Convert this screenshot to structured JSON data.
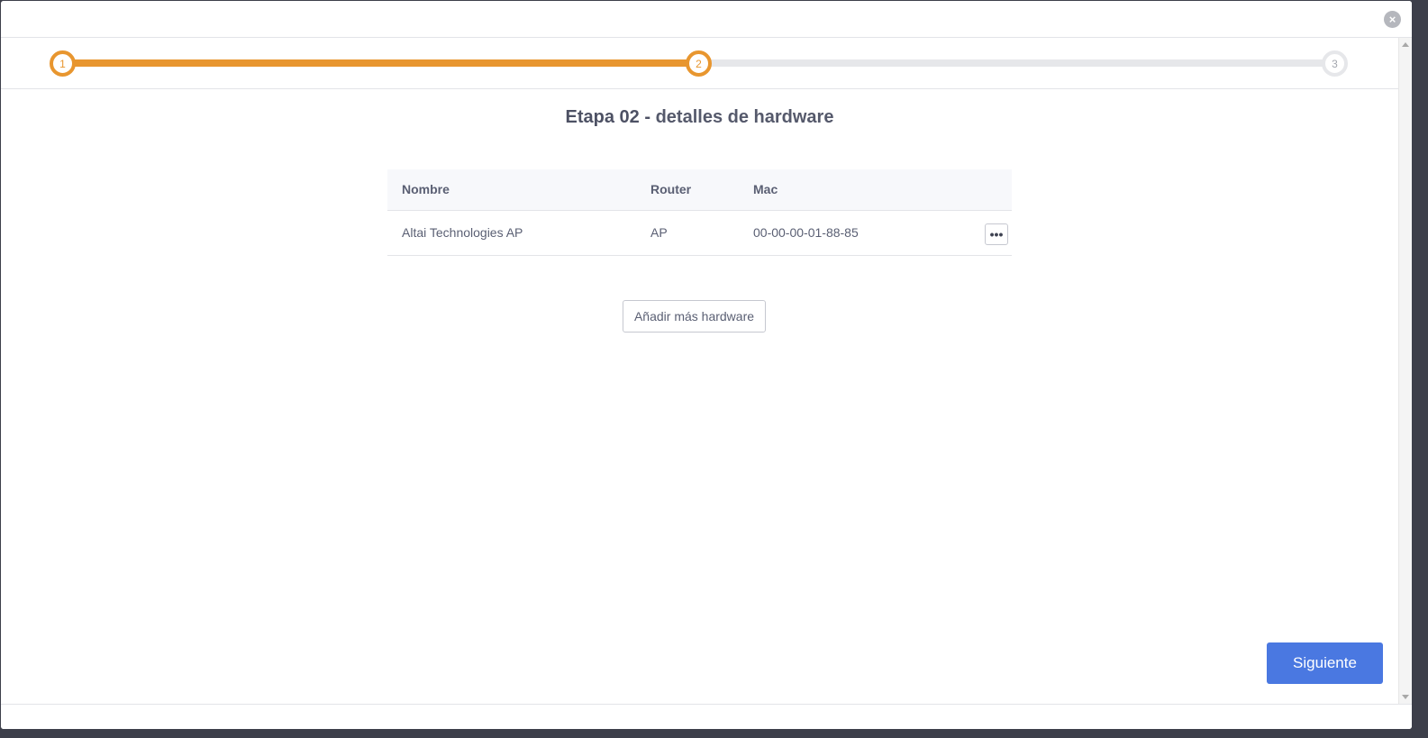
{
  "header": {
    "close_icon": "close-icon",
    "close_glyph": "×"
  },
  "stepper": {
    "steps": [
      {
        "label": "1",
        "state": "completed"
      },
      {
        "label": "2",
        "state": "active"
      },
      {
        "label": "3",
        "state": "pending"
      }
    ],
    "active_color": "#e8962f",
    "inactive_color": "#e6e7ea"
  },
  "page": {
    "title_bold": "Etapa 02 -",
    "title_rest": "detalles de hardware"
  },
  "table": {
    "columns": [
      "Nombre",
      "Router",
      "Mac"
    ],
    "rows": [
      {
        "name": "Altai Technologies AP",
        "router": "AP",
        "mac": "00-00-00-01-88-85",
        "actions_label": "•••"
      }
    ]
  },
  "actions": {
    "add_hardware_label": "Añadir más hardware",
    "next_label": "Siguiente",
    "next_color": "#4a78e1"
  }
}
